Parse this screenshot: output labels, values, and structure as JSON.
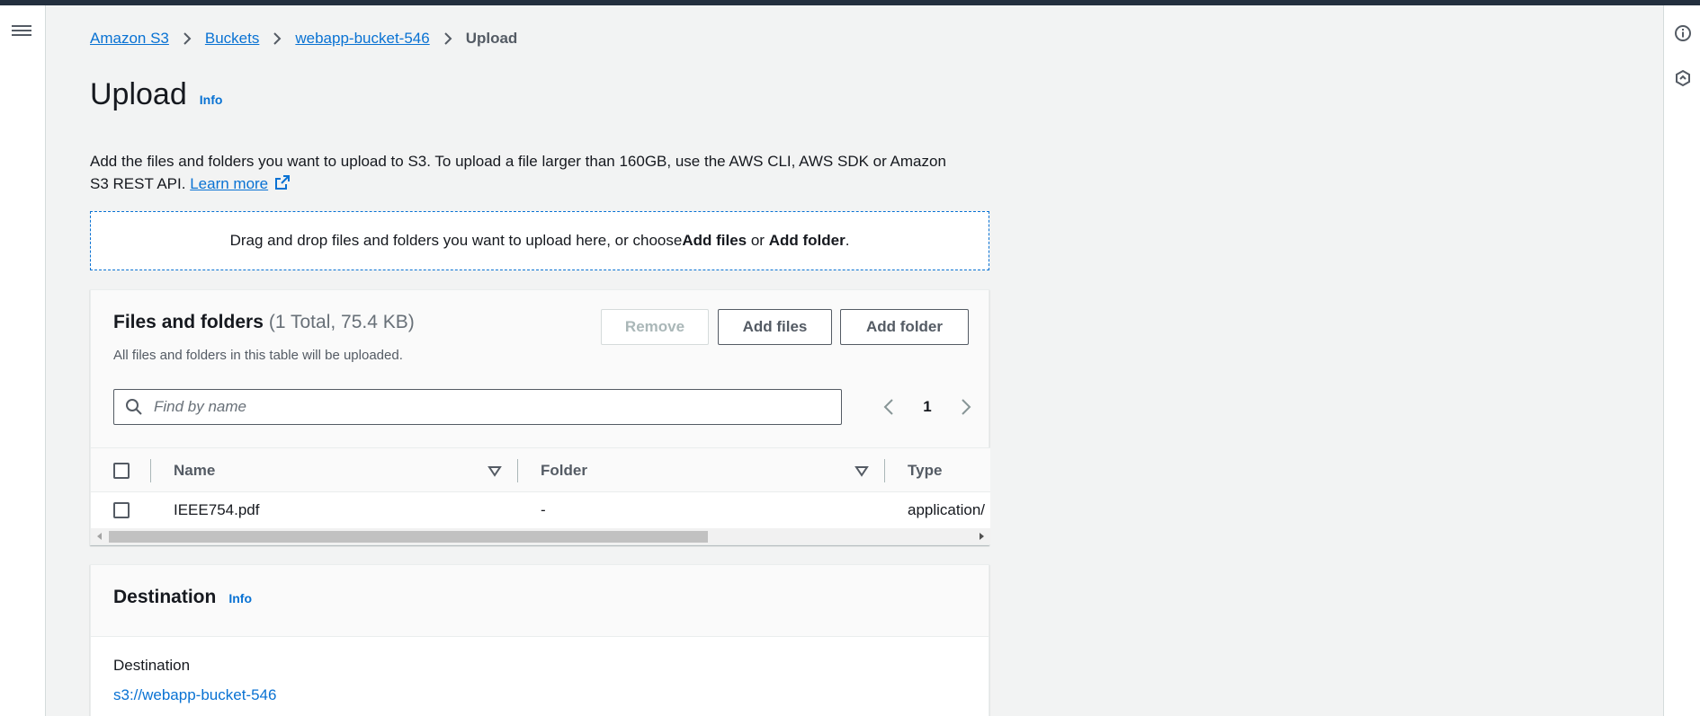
{
  "breadcrumb": {
    "items": [
      "Amazon S3",
      "Buckets",
      "webapp-bucket-546"
    ],
    "current": "Upload"
  },
  "page": {
    "title": "Upload",
    "info": "Info",
    "description_line1": "Add the files and folders you want to upload to S3. To upload a file larger than 160GB, use the AWS CLI, AWS SDK or Amazon",
    "description_line2": "S3 REST API.",
    "learn_more": "Learn more"
  },
  "dropzone": {
    "text_before": "Drag and drop files and folders you want to upload here, or choose ",
    "add_files": "Add files",
    "or": " or ",
    "add_folder": "Add folder",
    "end": "."
  },
  "files_panel": {
    "title": "Files and folders",
    "count": "(1 Total, 75.4 KB)",
    "subtitle": "All files and folders in this table will be uploaded.",
    "buttons": {
      "remove": "Remove",
      "add_files": "Add files",
      "add_folder": "Add folder"
    },
    "search_placeholder": "Find by name",
    "page": "1",
    "columns": [
      "Name",
      "Folder",
      "Type"
    ],
    "rows": [
      {
        "name": "IEEE754.pdf",
        "folder": "-",
        "type": "application/"
      }
    ]
  },
  "destination_panel": {
    "title": "Destination",
    "info": "Info",
    "label": "Destination",
    "value": "s3://webapp-bucket-546"
  },
  "colors": {
    "link": "#0972d3",
    "text": "#16191f",
    "muted": "#545b64",
    "background": "#f2f3f3",
    "topbar": "#232f3e"
  },
  "icons": {
    "menu": "hamburger-menu-icon",
    "info_circle": "info-circle-icon",
    "feedback": "hexagon-feedback-icon",
    "external_link": "external-link-icon",
    "search": "search-icon",
    "sort": "sort-caret-icon"
  }
}
